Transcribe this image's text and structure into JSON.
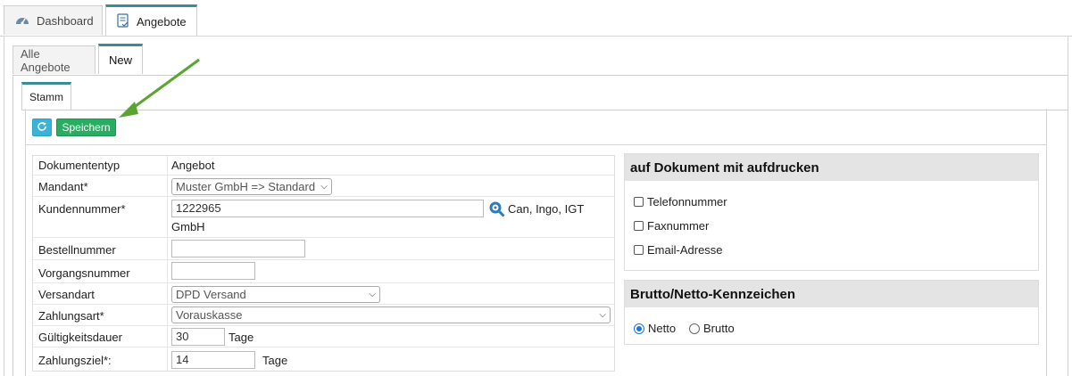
{
  "top_tabs": [
    {
      "label": "Dashboard",
      "icon": "dashboard-gauge-icon"
    },
    {
      "label": "Angebote",
      "icon": "document-check-icon"
    }
  ],
  "sub_tabs": [
    {
      "label": "Alle Angebote"
    },
    {
      "label": "New"
    }
  ],
  "section_tab": {
    "label": "Stamm"
  },
  "toolbar": {
    "refresh_icon": "refresh-icon",
    "save_label": "Speichern"
  },
  "form": {
    "dokumententyp": {
      "label": "Dokumententyp",
      "value": "Angebot"
    },
    "mandant": {
      "label": "Mandant*",
      "value": "Muster GmbH => Standard"
    },
    "kundennummer": {
      "label": "Kundennummer*",
      "value": "1222965",
      "lookup_icon": "search-lookup-icon",
      "customer_name_line1": "Can, Ingo, IGT",
      "customer_name_line2": "GmbH"
    },
    "bestellnummer": {
      "label": "Bestellnummer",
      "value": ""
    },
    "vorgangsnummer": {
      "label": "Vorgangsnummer",
      "value": ""
    },
    "versandart": {
      "label": "Versandart",
      "value": "DPD Versand"
    },
    "zahlungsart": {
      "label": "Zahlungsart*",
      "value": "Vorauskasse"
    },
    "gueltigkeitsdauer": {
      "label": "Gültigkeitsdauer",
      "value": "30",
      "unit": "Tage"
    },
    "zahlungsziel": {
      "label": "Zahlungsziel*:",
      "value": "14",
      "unit": "Tage"
    }
  },
  "print_options": {
    "title": "auf Dokument mit aufdrucken",
    "items": [
      {
        "label": "Telefonnummer",
        "checked": false
      },
      {
        "label": "Faxnummer",
        "checked": false
      },
      {
        "label": "Email-Adresse",
        "checked": false
      }
    ]
  },
  "brutto_netto": {
    "title": "Brutto/Netto-Kennzeichen",
    "options": [
      {
        "label": "Netto",
        "selected": true
      },
      {
        "label": "Brutto",
        "selected": false
      }
    ]
  },
  "colors": {
    "tab_accent": "#3a8c96",
    "save_button": "#27ae60",
    "refresh_button": "#39b3d7",
    "annotation_arrow": "#5aa532"
  }
}
